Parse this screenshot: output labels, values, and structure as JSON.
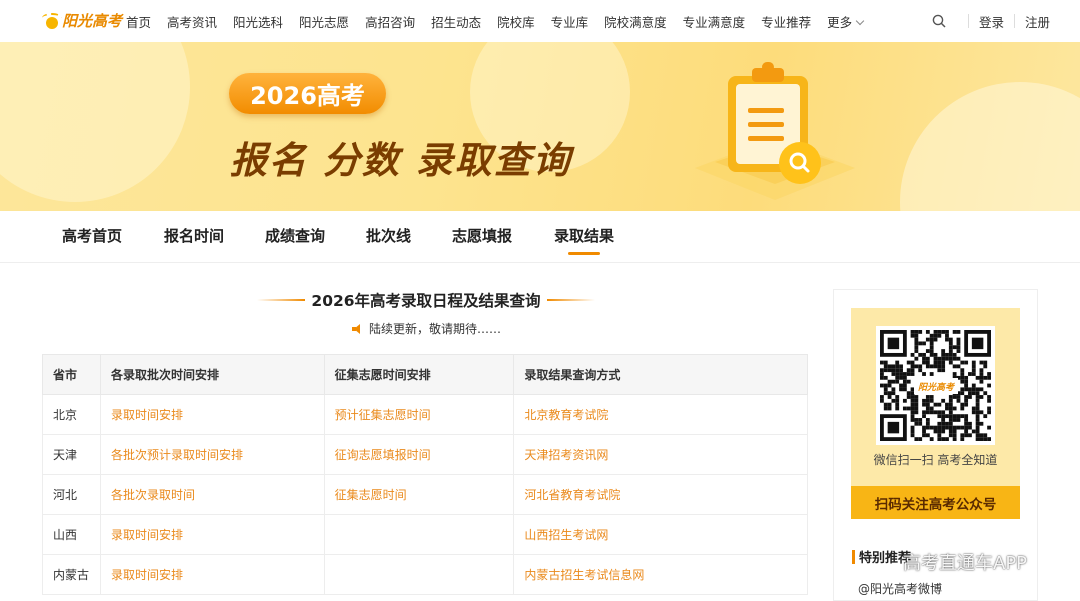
{
  "brand": {
    "logo_text": "阳光高考"
  },
  "topnav": {
    "links": [
      "首页",
      "高考资讯",
      "阳光选科",
      "阳光志愿",
      "高招咨询",
      "招生动态",
      "院校库",
      "专业库",
      "院校满意度",
      "专业满意度",
      "专业推荐",
      "更多"
    ],
    "login": "登录",
    "register": "注册"
  },
  "banner": {
    "pill": "2026高考",
    "headline": "报名 分数 录取查询"
  },
  "subnav": {
    "items": [
      "高考首页",
      "报名时间",
      "成绩查询",
      "批次线",
      "志愿填报",
      "录取结果"
    ],
    "active_index": 5
  },
  "main": {
    "title": "2026年高考录取日程及结果查询",
    "note": "陆续更新，敬请期待……",
    "table": {
      "headers": [
        "省市",
        "各录取批次时间安排",
        "征集志愿时间安排",
        "录取结果查询方式"
      ],
      "rows": [
        [
          "北京",
          "录取时间安排",
          "预计征集志愿时间",
          "北京教育考试院"
        ],
        [
          "天津",
          "各批次预计录取时间安排",
          "征询志愿填报时间",
          "天津招考资讯网"
        ],
        [
          "河北",
          "各批次录取时间",
          "征集志愿时间",
          "河北省教育考试院"
        ],
        [
          "山西",
          "录取时间安排",
          "",
          "山西招生考试网"
        ],
        [
          "内蒙古",
          "录取时间安排",
          "",
          "内蒙古招生考试信息网"
        ]
      ]
    }
  },
  "sidebar": {
    "qr_logo_text": "阳光高考",
    "qr_caption": "微信扫一扫 高考全知道",
    "qr_button": "扫码关注高考公众号",
    "special_title": "特别推荐",
    "special_item": "@阳光高考微博"
  },
  "watermark": "高考直通车APP",
  "colors": {
    "accent": "#f08a00",
    "link": "#ea8a1c",
    "banner_bg": "#fde48f",
    "headline": "#7a3d00"
  }
}
